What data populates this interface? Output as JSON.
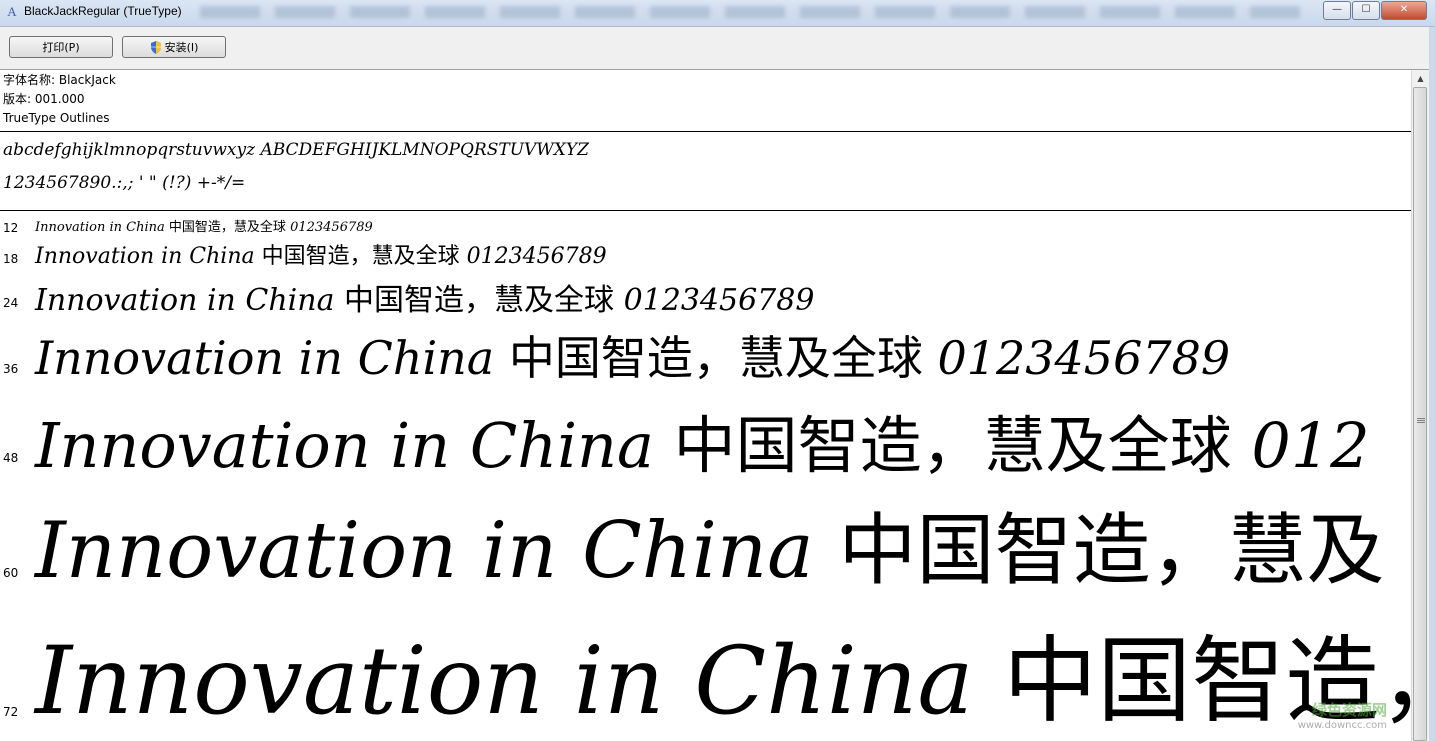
{
  "window": {
    "title": "BlackJackRegular (TrueType)",
    "icon": "font-icon",
    "controls": {
      "minimize": "—",
      "maximize": "☐",
      "close": "✕"
    }
  },
  "toolbar": {
    "print_label": "打印(P)",
    "install_label": "安装(I)"
  },
  "info": {
    "font_name": "字体名称: BlackJack",
    "version": "版本: 001.000",
    "outline_type": "TrueType Outlines"
  },
  "charset": {
    "letters": "abcdefghijklmnopqrstuvwxyz ABCDEFGHIJKLMNOPQRSTUVWXYZ",
    "digits_symbols": "1234567890.:,; ' \" (!?) +-*/="
  },
  "samples": [
    {
      "size": "12",
      "latin": "Innovation in China ",
      "cjk": "中国智造，慧及全球 ",
      "digits": "0123456789"
    },
    {
      "size": "18",
      "latin": "Innovation in China ",
      "cjk": "中国智造，慧及全球 ",
      "digits": "0123456789"
    },
    {
      "size": "24",
      "latin": "Innovation in China ",
      "cjk": "中国智造，慧及全球 ",
      "digits": "0123456789"
    },
    {
      "size": "36",
      "latin": "Innovation in China ",
      "cjk": "中国智造，慧及全球 ",
      "digits": "0123456789"
    },
    {
      "size": "48",
      "latin": "Innovation in China ",
      "cjk": "中国智造，慧及全球 ",
      "digits": "012"
    },
    {
      "size": "60",
      "latin": "Innovation in China ",
      "cjk": "中国智造，慧及",
      "digits": ""
    },
    {
      "size": "72",
      "latin": "Innovation in China ",
      "cjk": "中国智造，",
      "digits": ""
    }
  ],
  "watermark": {
    "main": "绿色资源网",
    "sub": "www.downcc.com"
  }
}
